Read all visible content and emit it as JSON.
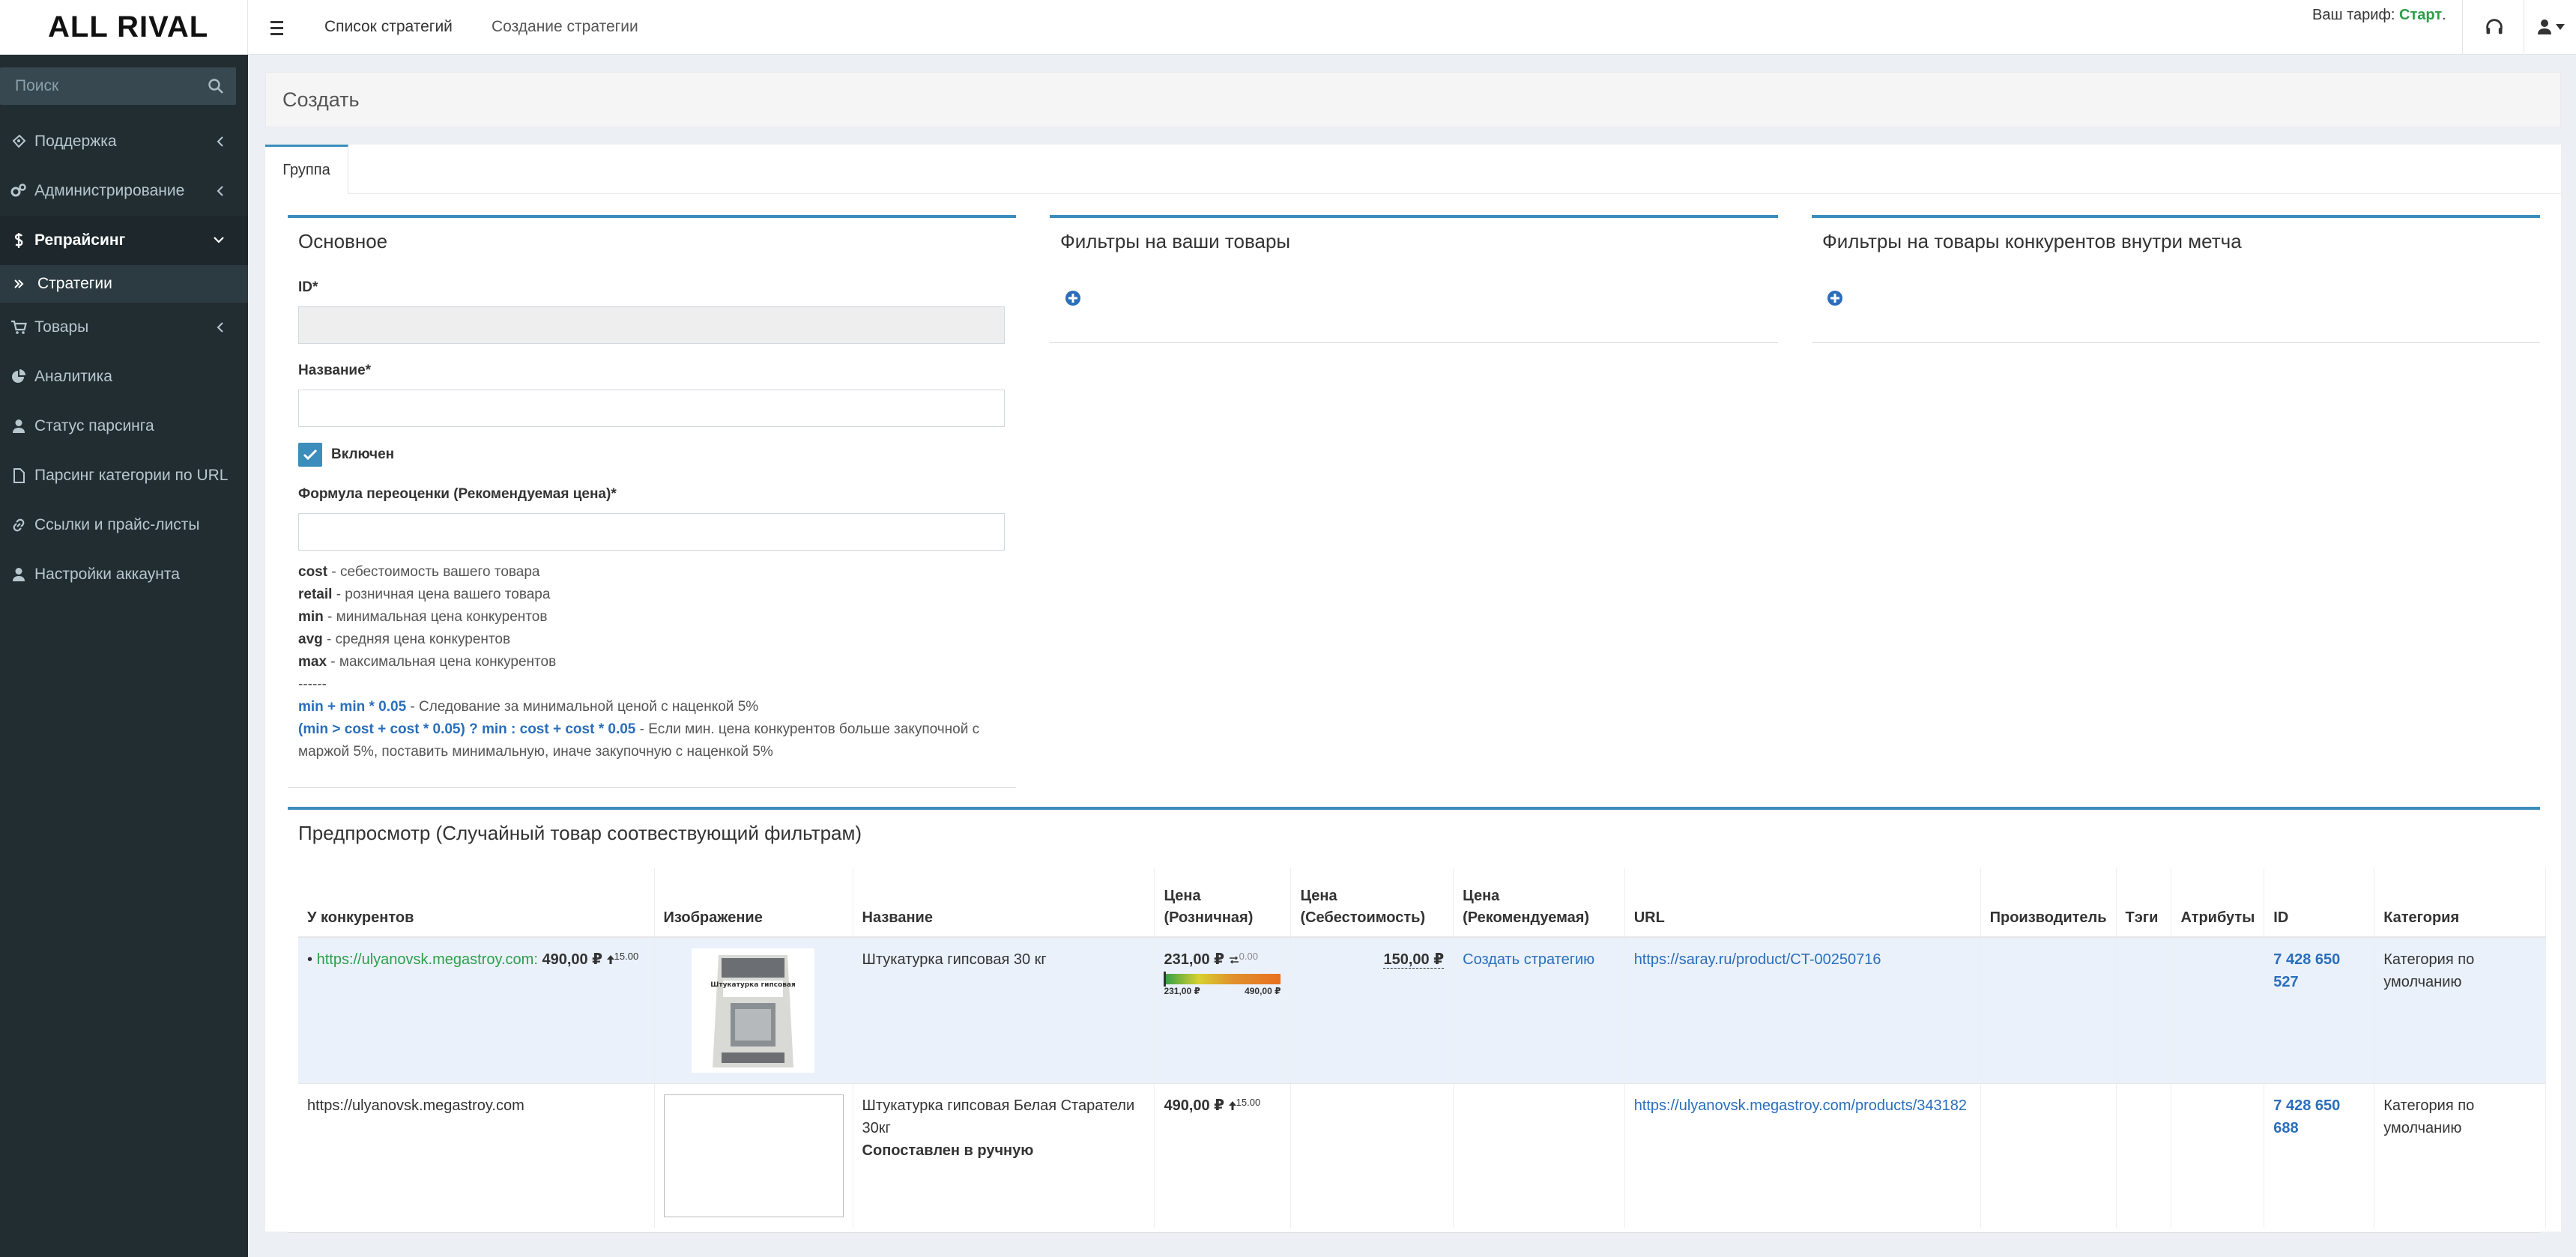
{
  "app": {
    "logo": "ALL RIVAL"
  },
  "header": {
    "links": [
      "Список стратегий",
      "Создание стратегии"
    ],
    "tariff_label": "Ваш тариф:",
    "tariff_value": "Старт",
    "tariff_suffix": "."
  },
  "sidebar": {
    "search_placeholder": "Поиск",
    "items": [
      {
        "label": "Поддержка",
        "icon": "support-icon"
      },
      {
        "label": "Администрирование",
        "icon": "cogs-icon"
      },
      {
        "label": "Репрайсинг",
        "icon": "dollar-icon"
      },
      {
        "label": "Товары",
        "icon": "cart-icon"
      },
      {
        "label": "Аналитика",
        "icon": "pie-chart-icon"
      },
      {
        "label": "Статус парсинга",
        "icon": "user-icon"
      },
      {
        "label": "Парсинг категории по URL",
        "icon": "document-icon"
      },
      {
        "label": "Ссылки и прайс-листы",
        "icon": "link-icon"
      },
      {
        "label": "Настройки аккаунта",
        "icon": "user-icon"
      }
    ],
    "sub_item": "Стратегии"
  },
  "page": {
    "title": "Создать",
    "tab": "Группа"
  },
  "basic": {
    "title": "Основное",
    "id_label": "ID*",
    "id_value": "",
    "name_label": "Название*",
    "name_value": "",
    "enabled_label": "Включен",
    "enabled": true,
    "formula_label": "Формула переоценки (Рекомендуемая цена)*",
    "formula_value": "",
    "help": [
      {
        "key": "cost",
        "text": " - себестоимость вашего товара"
      },
      {
        "key": "retail",
        "text": " - розничная цена вашего товара"
      },
      {
        "key": "min",
        "text": " - минимальная цена конкурентов"
      },
      {
        "key": "avg",
        "text": " - средняя цена конкурентов"
      },
      {
        "key": "max",
        "text": " - максимальная цена конкурентов"
      }
    ],
    "separator": "------",
    "example1_code": "min + min * 0.05",
    "example1_text": " - Следование за минимальной ценой с наценкой 5%",
    "example2_code": "(min > cost + cost * 0.05) ? min : cost + cost * 0.05",
    "example2_text": " - Если мин. цена конкурентов больше закупочной с",
    "example2_text2": "маржой 5%, поставить минимальную, иначе закупочную с наценкой 5%"
  },
  "filters_own": {
    "title": "Фильтры на ваши товары"
  },
  "filters_comp": {
    "title": "Фильтры на товары конкурентов внутри метча"
  },
  "preview": {
    "title": "Предпросмотр (Случайный товар соотвествующий фильтрам)",
    "columns": {
      "competitors": "У конкурентов",
      "image": "Изображение",
      "name": "Название",
      "price_retail_1": "Цена",
      "price_retail_2": "(Розничная)",
      "price_cost_1": "Цена",
      "price_cost_2": "(Себестоимость)",
      "price_rec_1": "Цена",
      "price_rec_2": "(Рекомендуемая)",
      "url": "URL",
      "manufacturer": "Производитель",
      "tags": "Тэги",
      "attributes": "Атрибуты",
      "id": "ID",
      "category": "Категория"
    },
    "row1": {
      "bullet": "•",
      "competitor_link": "https://ulyanovsk.megastroy.com:",
      "competitor_price": "490,00 ₽",
      "competitor_delta": "15.00",
      "product_image_label": "Штукатурка гипсовая",
      "name": "Штукатурка гипсовая 30 кг",
      "retail": "231,00 ₽",
      "retail_delta": "0.00",
      "bar_min": "231,00 ₽",
      "bar_max": "490,00 ₽",
      "cost": "150,00 ₽",
      "recommended": "Создать стратегию",
      "url": "https://saray.ru/product/CT-00250716",
      "manufacturer": "",
      "tags": "",
      "attributes": "",
      "id": "7 428 650 527",
      "category": "Категория по умолчанию"
    },
    "row2": {
      "competitor": "https://ulyanovsk.megastroy.com",
      "name": "Штукатурка гипсовая Белая Старатели 30кг",
      "manual": "Сопоставлен в ручную",
      "retail": "490,00 ₽",
      "retail_delta": "15.00",
      "cost": "",
      "recommended": "",
      "url": "https://ulyanovsk.megastroy.com/products/343182",
      "manufacturer": "",
      "tags": "",
      "attributes": "",
      "id": "7 428 650 688",
      "category": "Категория по умолчанию"
    }
  }
}
